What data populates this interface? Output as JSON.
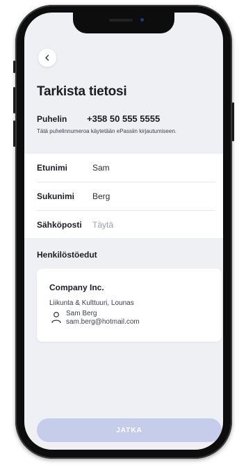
{
  "header": {
    "title": "Tarkista tietosi"
  },
  "phone": {
    "label": "Puhelin",
    "value": "+358 50 555 5555",
    "note": "Tätä puhelinnumeroa käytetään ePassiin kirjautumiseen."
  },
  "form": {
    "first_name": {
      "label": "Etunimi",
      "value": "Sam"
    },
    "last_name": {
      "label": "Sukunimi",
      "value": "Berg"
    },
    "email": {
      "label": "Sähköposti",
      "placeholder": "Täytä"
    }
  },
  "benefits": {
    "title": "Henkilöstöedut",
    "card": {
      "company": "Company Inc.",
      "benefit_types": "Liikunta & Kulttuuri, Lounas",
      "person_name": "Sam Berg",
      "person_email": "sam.berg@hotmail.com"
    }
  },
  "actions": {
    "continue_label": "JATKA"
  },
  "colors": {
    "accent_disabled": "#c5cdeb",
    "background": "#eef0f3"
  }
}
